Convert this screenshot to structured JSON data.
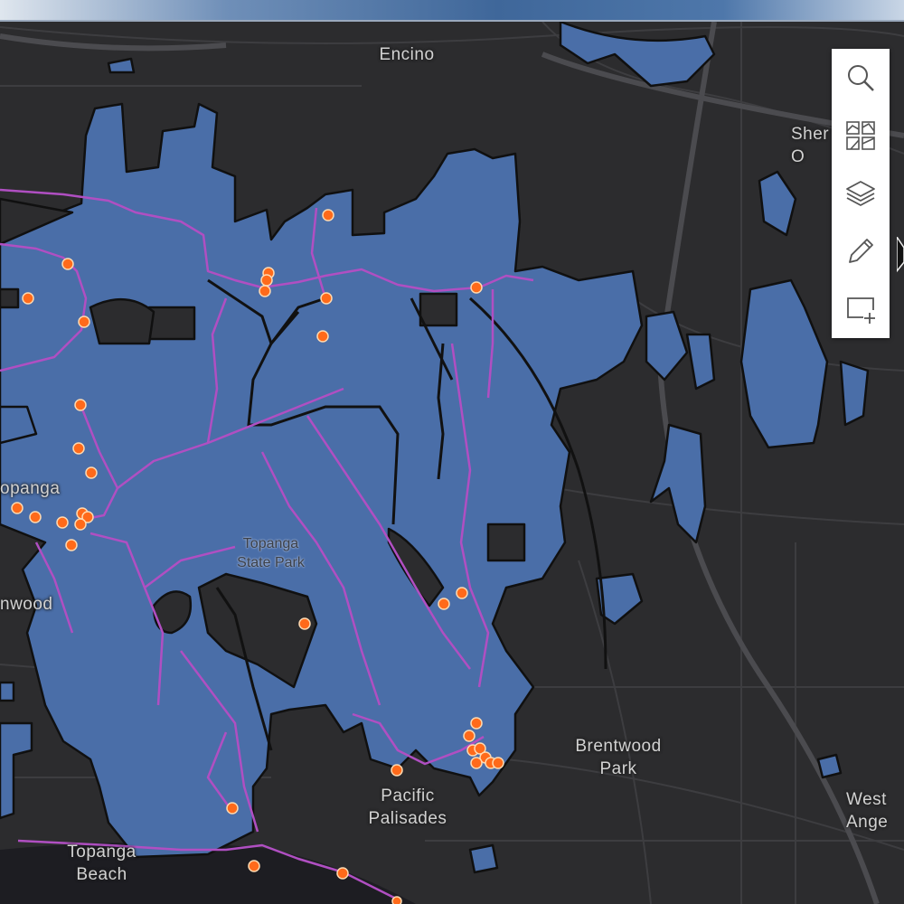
{
  "map": {
    "place_labels": {
      "encino": "Encino",
      "sherman_oaks": "Sher\nO",
      "topanga": "opanga",
      "brentwood_west": "nwood",
      "brentwood_park": "Brentwood\nPark",
      "pacific_palisades": "Pacific\nPalisades",
      "topanga_beach": "Topanga\nBeach",
      "west_angeles": "West\nAnge"
    },
    "park_label": "Topanga\nState Park",
    "colors": {
      "basemap": "#2c2c2e",
      "ocean": "#1d1d22",
      "park_fill": "#4a6ea8",
      "park_outline": "#101010",
      "trails": "#b04fc2",
      "markers": "#ff6a1a"
    }
  },
  "toolbar": {
    "tools": [
      {
        "name": "search",
        "icon": "search-icon"
      },
      {
        "name": "basemap-gallery",
        "icon": "basemap-gallery-icon"
      },
      {
        "name": "layers",
        "icon": "layers-icon"
      },
      {
        "name": "edit",
        "icon": "pencil-icon"
      },
      {
        "name": "add-item",
        "icon": "add-item-icon"
      }
    ]
  }
}
